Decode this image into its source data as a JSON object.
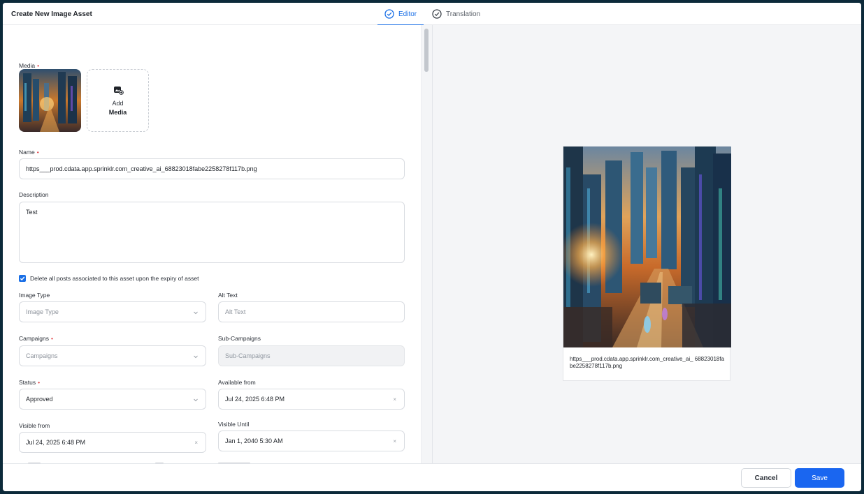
{
  "header": {
    "title": "Create New Image Asset",
    "tabs": [
      {
        "label": "Editor",
        "active": true,
        "icon": "check-circle-icon"
      },
      {
        "label": "Translation",
        "active": false,
        "icon": "check-circle-icon"
      }
    ]
  },
  "form": {
    "media": {
      "label": "Media",
      "add_line1": "Add",
      "add_line2": "Media"
    },
    "name": {
      "label": "Name",
      "value": "https___prod.cdata.app.sprinklr.com_creative_ai_68823018fabe2258278f117b.png"
    },
    "description": {
      "label": "Description",
      "value": "Test"
    },
    "delete_posts": {
      "label": "Delete all posts associated to this asset upon the expiry of asset",
      "checked": true
    },
    "image_type": {
      "label": "Image Type",
      "placeholder": "Image Type"
    },
    "alt_text": {
      "label": "Alt Text",
      "placeholder": "Alt Text"
    },
    "campaigns": {
      "label": "Campaigns",
      "placeholder": "Campaigns"
    },
    "sub_campaigns": {
      "label": "Sub-Campaigns",
      "placeholder": "Sub-Campaigns"
    },
    "status": {
      "label": "Status",
      "value": "Approved"
    },
    "available_from": {
      "label": "Available from",
      "value": "Jul 24, 2025 6:48 PM"
    },
    "visible_from": {
      "label": "Visible from",
      "value": "Jul 24, 2025 6:48 PM"
    },
    "visible_until": {
      "label": "Visible Until",
      "value": "Jan 1, 2040 5:30 AM"
    },
    "clear_glyph": "×"
  },
  "preview": {
    "caption": "https___prod.cdata.app.sprinklr.com_creative_ai_ 68823018fabe2258278f117b.png"
  },
  "footer": {
    "cancel_label": "Cancel",
    "save_label": "Save"
  },
  "colors": {
    "accent": "#1a66f0",
    "required": "#e0393e",
    "frame_border": "#0c2a3a"
  }
}
